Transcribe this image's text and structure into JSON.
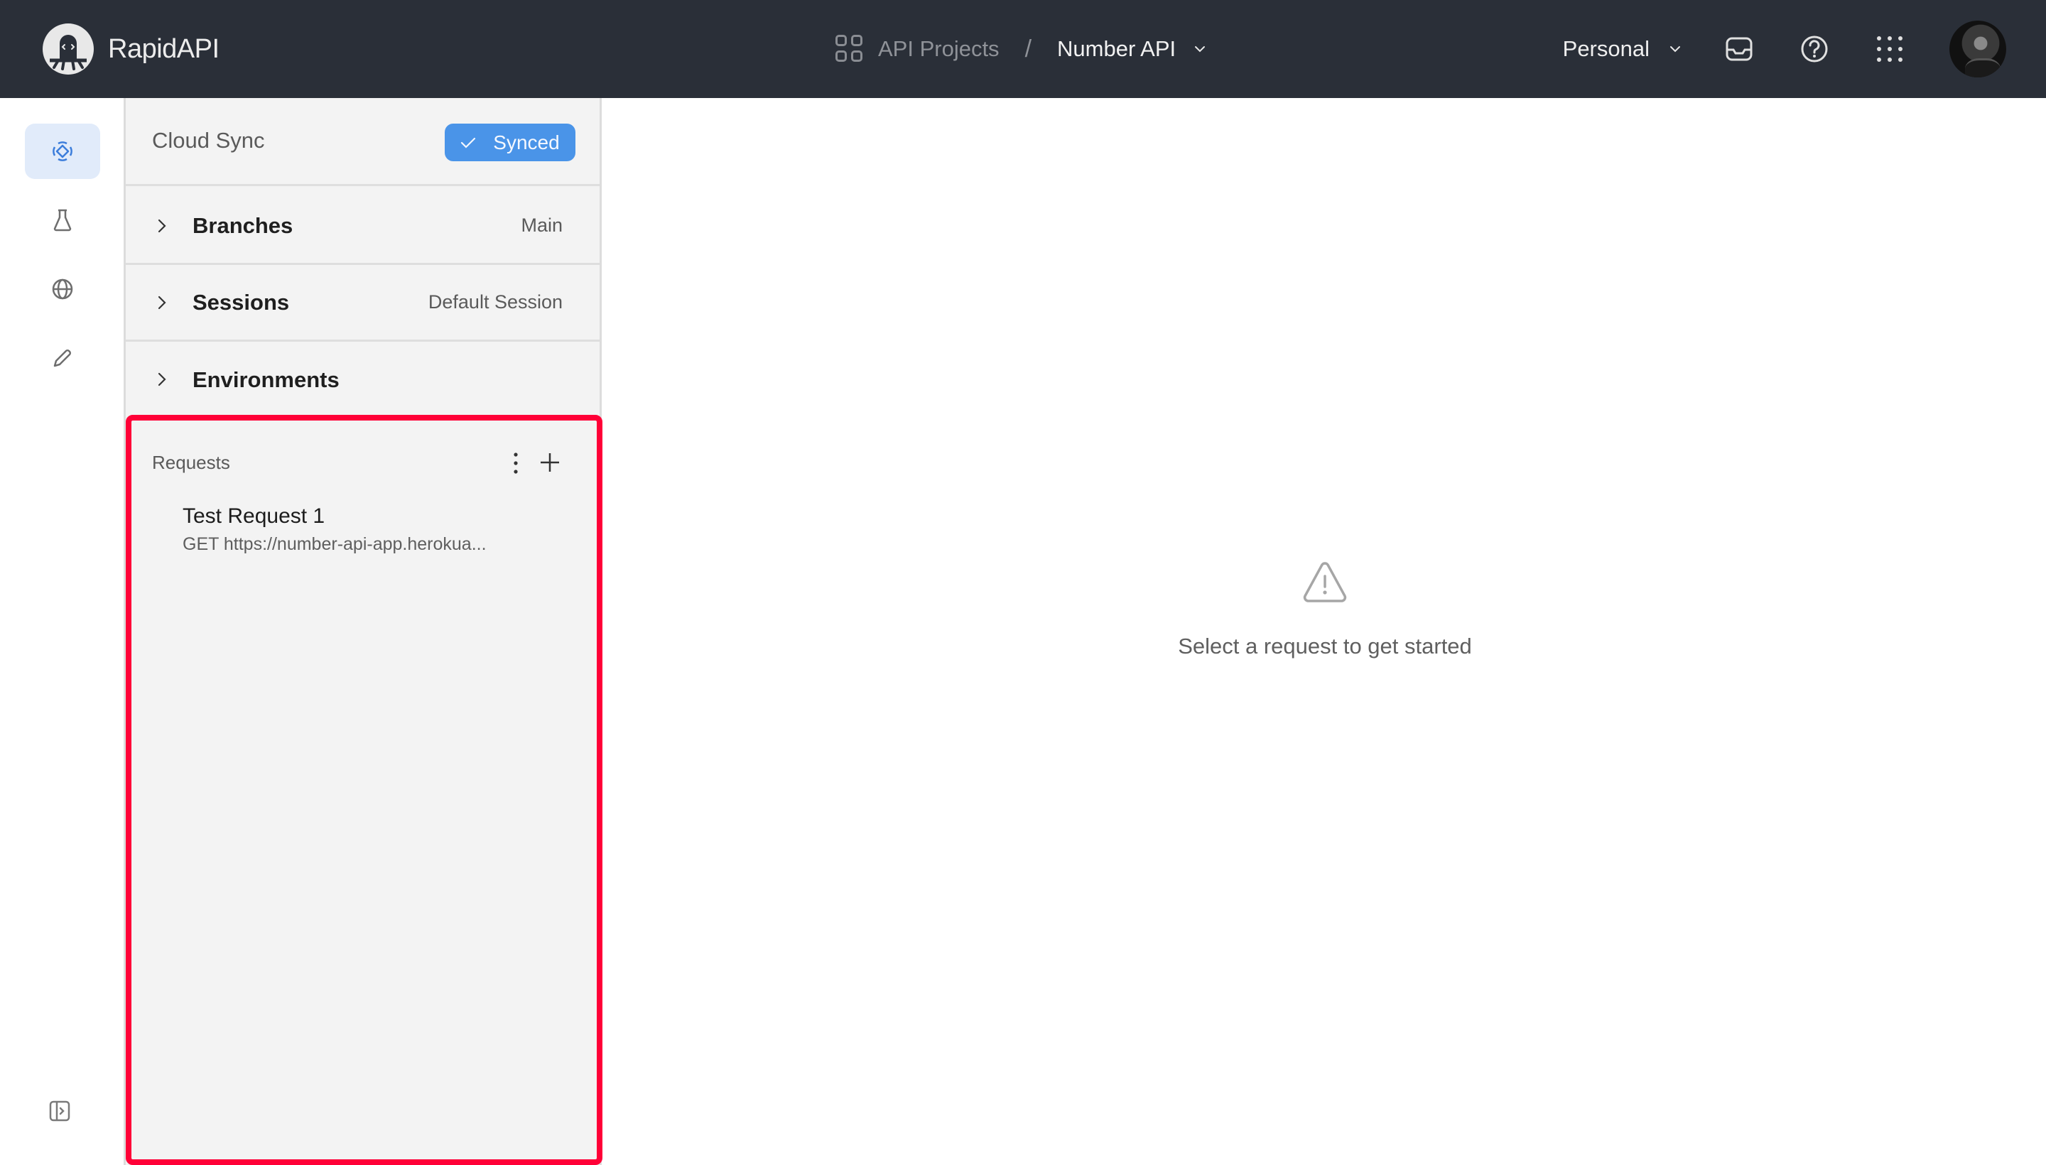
{
  "header": {
    "brand_name": "RapidAPI",
    "breadcrumb": {
      "projects_label": "API Projects",
      "separator": "/",
      "current_project": "Number API"
    },
    "workspace": "Personal",
    "icons": [
      "inbox-icon",
      "help-icon",
      "apps-grid-icon"
    ],
    "accent_bg": "#2a2f38"
  },
  "rail": {
    "items": [
      {
        "name": "api-design-icon",
        "active": true
      },
      {
        "name": "test-flask-icon",
        "active": false
      },
      {
        "name": "globe-icon",
        "active": false
      },
      {
        "name": "pencil-icon",
        "active": false
      }
    ],
    "collapse_icon": "sidebar-expand-icon",
    "active_color": "#3b7ddb"
  },
  "sidebar": {
    "cloud_sync": {
      "title": "Cloud Sync",
      "status_label": "Synced",
      "status_color": "#4a94e8"
    },
    "sections": [
      {
        "label": "Branches",
        "value": "Main"
      },
      {
        "label": "Sessions",
        "value": "Default Session"
      },
      {
        "label": "Environments",
        "value": ""
      }
    ],
    "requests": {
      "title": "Requests",
      "items": [
        {
          "name": "Test Request 1",
          "method": "GET",
          "url": "GET https://number-api-app.herokua..."
        }
      ],
      "highlight_color": "#ff0037"
    }
  },
  "main": {
    "empty_state": {
      "icon": "warning-icon",
      "message": "Select a request to get started"
    }
  }
}
